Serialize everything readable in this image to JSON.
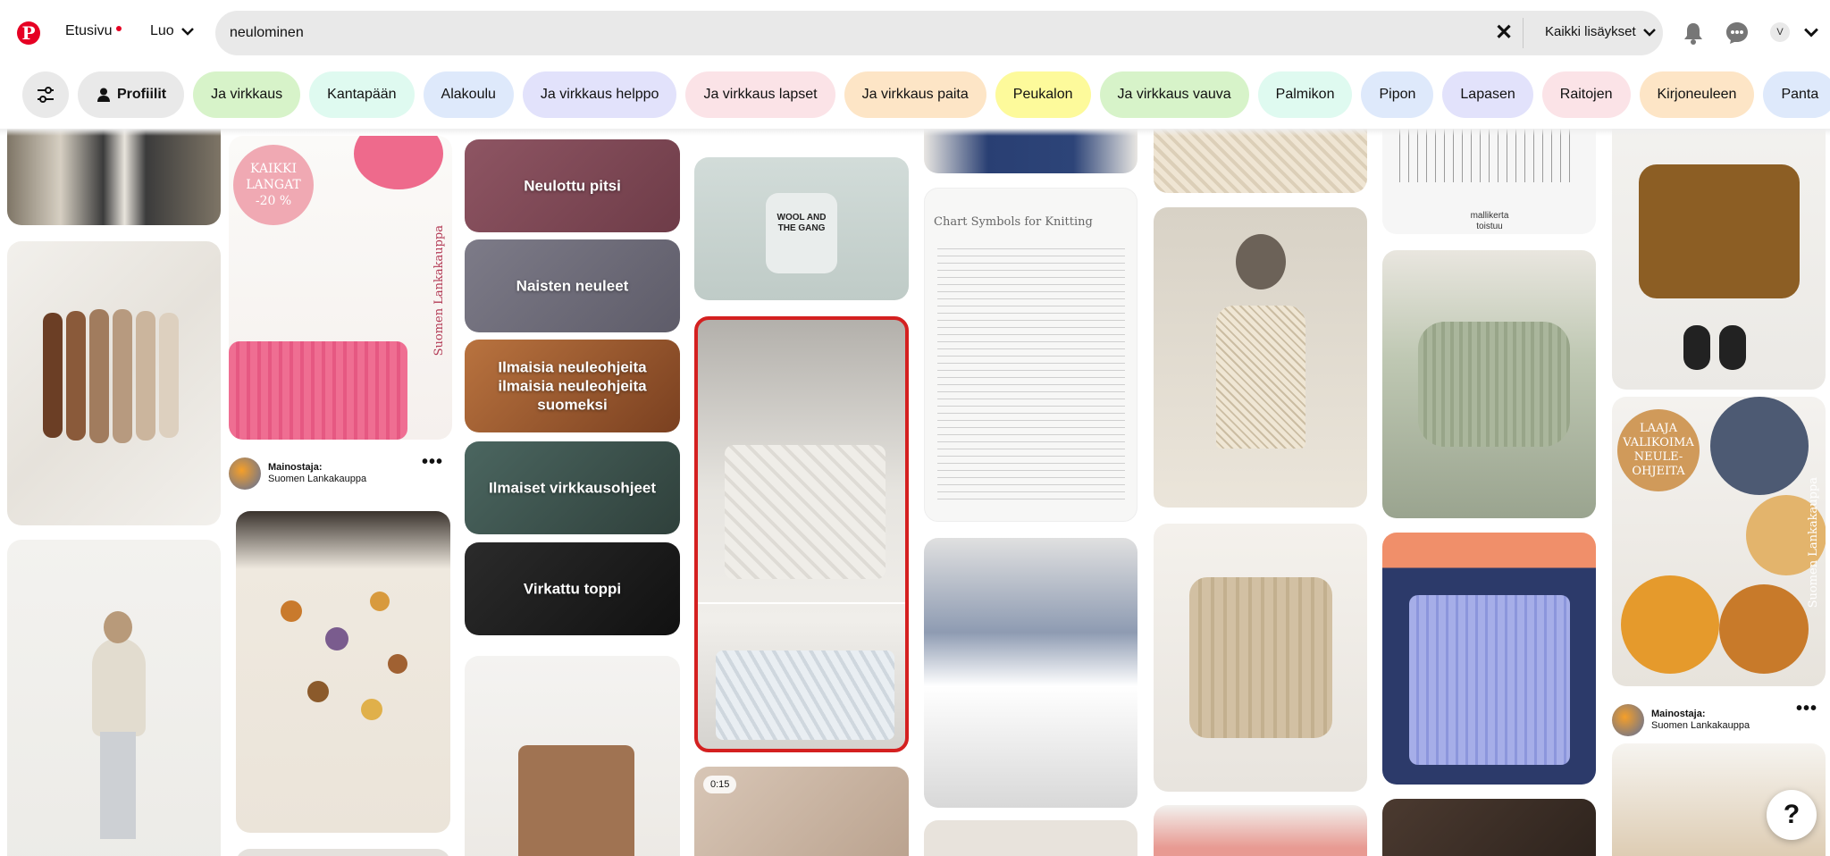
{
  "header": {
    "logo": "P",
    "nav_home": "Etusivu",
    "nav_create": "Luo",
    "search_value": "neulominen",
    "search_filter": "Kaikki lisäykset",
    "avatar_letter": "V"
  },
  "chips": [
    {
      "label": "Profiilit",
      "color": "#e9e9e9"
    },
    {
      "label": "Ja virkkaus",
      "color": "#d7f3c9"
    },
    {
      "label": "Kantapään",
      "color": "#dffaf0"
    },
    {
      "label": "Alakoulu",
      "color": "#dee9fb"
    },
    {
      "label": "Ja virkkaus helppo",
      "color": "#e2e2fb"
    },
    {
      "label": "Ja virkkaus lapset",
      "color": "#fbe3e7"
    },
    {
      "label": "Ja virkkaus paita",
      "color": "#fde5c6"
    },
    {
      "label": "Peukalon",
      "color": "#fdfa9b"
    },
    {
      "label": "Ja virkkaus vauva",
      "color": "#d7f3c9"
    },
    {
      "label": "Palmikon",
      "color": "#dffaf0"
    },
    {
      "label": "Pipon",
      "color": "#dee9fb"
    },
    {
      "label": "Lapasen",
      "color": "#e2e2fb"
    },
    {
      "label": "Raitojen",
      "color": "#fbe3e7"
    },
    {
      "label": "Kirjoneuleen",
      "color": "#fde5c6"
    },
    {
      "label": "Panta",
      "color": "#dee9fb"
    }
  ],
  "pins": {
    "ad1_badge_line1": "KAIKKI",
    "ad1_badge_line2": "LANGAT",
    "ad1_badge_line3": "-20 %",
    "ad1_vertical": "Suomen Lankakauppa",
    "ad_label": "Mainostaja:",
    "ad_name": "Suomen Lankakauppa",
    "board1": "Neulottu pitsi",
    "board2": "Naisten neuleet",
    "board3": "Ilmaisia neuleohjeita ilmaisia neuleohjeita suomeksi",
    "board4": "Ilmaiset virkkausohjeet",
    "board5": "Virkattu toppi",
    "yarn_label": "WOOL AND THE GANG",
    "video_time": "0:15",
    "chart_title": "Chart Symbols for Knitting",
    "pattern_label1": "mallikerta",
    "pattern_label2": "toistuu",
    "ad2_badge_line1": "LAAJA",
    "ad2_badge_line2": "VALIKOIMA",
    "ad2_badge_line3": "NEULE-",
    "ad2_badge_line4": "OHJEITA",
    "ad2_vertical": "Suomen Lankakauppa"
  },
  "help": "?"
}
